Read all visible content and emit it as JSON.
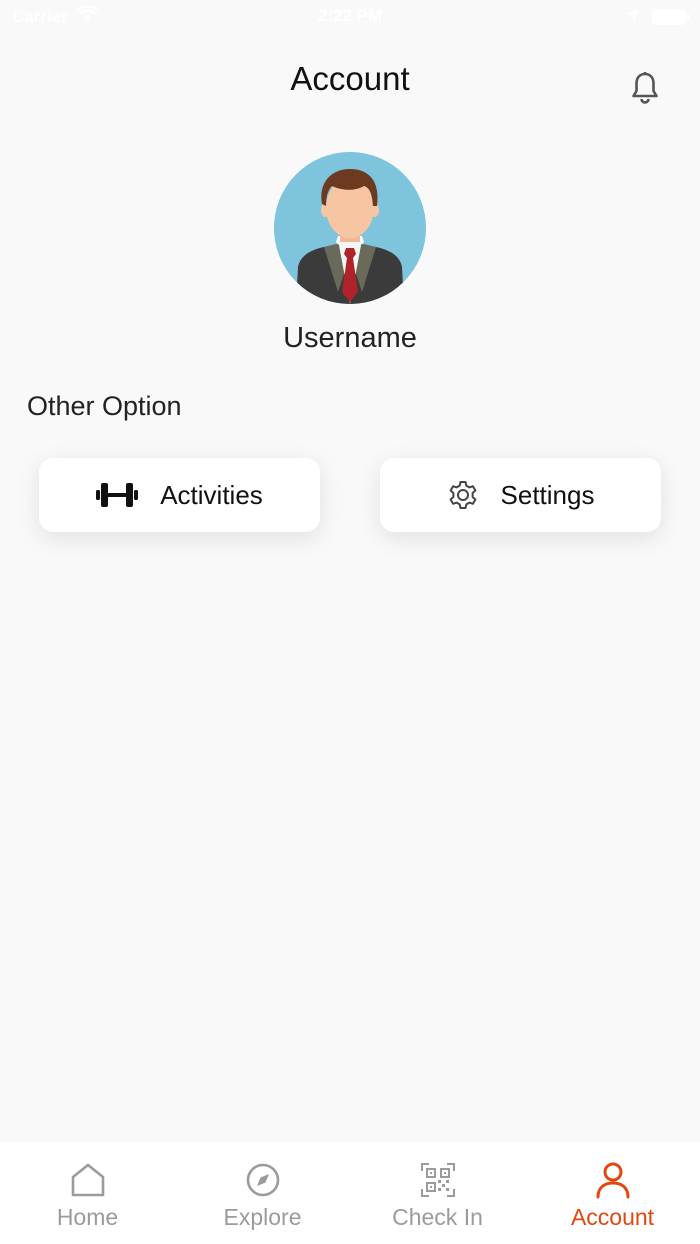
{
  "status_bar": {
    "carrier": "Carrier",
    "time": "2:22 PM"
  },
  "header": {
    "title": "Account",
    "notification_icon": "bell-icon"
  },
  "profile": {
    "avatar_icon": "user-avatar",
    "username": "Username"
  },
  "options": {
    "section_title": "Other Option",
    "items": [
      {
        "label": "Activities",
        "icon": "dumbbell-icon"
      },
      {
        "label": "Settings",
        "icon": "gear-icon"
      }
    ]
  },
  "tab_bar": {
    "items": [
      {
        "label": "Home",
        "icon": "home-icon",
        "active": false
      },
      {
        "label": "Explore",
        "icon": "compass-icon",
        "active": false
      },
      {
        "label": "Check In",
        "icon": "qr-code-icon",
        "active": false
      },
      {
        "label": "Account",
        "icon": "person-icon",
        "active": true
      }
    ],
    "active_color": "#e2470f",
    "inactive_color": "#9b9b9b"
  }
}
